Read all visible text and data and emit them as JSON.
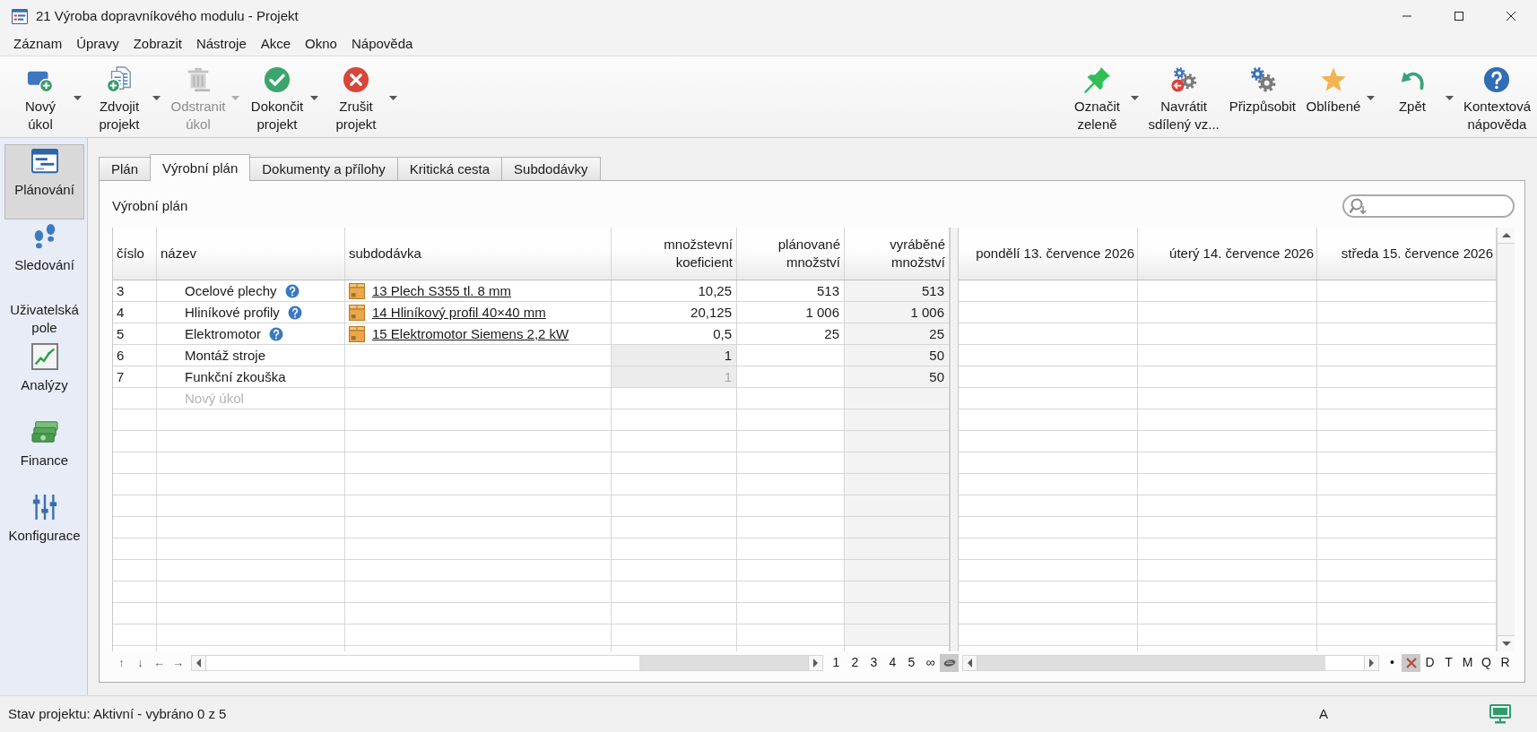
{
  "window": {
    "title": "21 Výroba dopravníkového modulu - Projekt"
  },
  "menu": [
    "Záznam",
    "Úpravy",
    "Zobrazit",
    "Nástroje",
    "Akce",
    "Okno",
    "Nápověda"
  ],
  "toolbar": {
    "left": [
      {
        "lines": [
          "Nový",
          "úkol"
        ],
        "dropdown": true,
        "disabled": false
      },
      {
        "lines": [
          "Zdvojit",
          "projekt"
        ],
        "dropdown": true,
        "disabled": false
      },
      {
        "lines": [
          "Odstranit",
          "úkol"
        ],
        "dropdown": true,
        "disabled": true
      },
      {
        "lines": [
          "Dokončit",
          "projekt"
        ],
        "dropdown": true,
        "disabled": false
      },
      {
        "lines": [
          "Zrušit",
          "projekt"
        ],
        "dropdown": true,
        "disabled": false
      }
    ],
    "right": [
      {
        "lines": [
          "Označit",
          "zeleně"
        ],
        "dropdown": true,
        "disabled": false
      },
      {
        "lines": [
          "Navrátit",
          "sdílený vz..."
        ],
        "dropdown": false,
        "disabled": false
      },
      {
        "lines": [
          "Přizpůsobit"
        ],
        "dropdown": false,
        "disabled": false
      },
      {
        "lines": [
          "Oblíbené"
        ],
        "dropdown": true,
        "disabled": false
      },
      {
        "lines": [
          "Zpět"
        ],
        "dropdown": true,
        "disabled": false
      },
      {
        "lines": [
          "Kontextová",
          "nápověda"
        ],
        "dropdown": false,
        "disabled": false
      }
    ]
  },
  "sidebar": {
    "items": [
      {
        "label": "Plánování",
        "selected": true
      },
      {
        "label": "Sledování",
        "selected": false
      },
      {
        "label": "Uživatelská pole",
        "selected": false
      },
      {
        "label": "Analýzy",
        "selected": false
      },
      {
        "label": "Finance",
        "selected": false
      },
      {
        "label": "Konfigurace",
        "selected": false
      }
    ]
  },
  "tabs": [
    {
      "label": "Plán",
      "selected": false
    },
    {
      "label": "Výrobní plán",
      "selected": true
    },
    {
      "label": "Dokumenty a přílohy",
      "selected": false
    },
    {
      "label": "Kritická cesta",
      "selected": false
    },
    {
      "label": "Subdodávky",
      "selected": false
    }
  ],
  "panel": {
    "title": "Výrobní plán"
  },
  "grid": {
    "columns": [
      {
        "label": "číslo",
        "kind": "text",
        "readonly": false
      },
      {
        "label": "název",
        "kind": "text",
        "readonly": false
      },
      {
        "label": "subdodávka",
        "kind": "text",
        "readonly": false
      },
      {
        "label": "množstevní koeficient",
        "kind": "number",
        "readonly": false
      },
      {
        "label": "plánované množství",
        "kind": "number",
        "readonly": false
      },
      {
        "label": "vyráběné množství",
        "kind": "number",
        "readonly": true
      }
    ],
    "rows": [
      {
        "number": "3",
        "name": "Ocelové plechy",
        "help": true,
        "subdelivery": "13 Plech S355 tl. 8 mm",
        "coefficient": "10,25",
        "coefficient_locked": false,
        "coefficient_dimmed": false,
        "planned": "513",
        "produced": "513"
      },
      {
        "number": "4",
        "name": "Hliníkové profily",
        "help": true,
        "subdelivery": "14 Hliníkový profil 40×40 mm",
        "coefficient": "20,125",
        "coefficient_locked": false,
        "coefficient_dimmed": false,
        "planned": "1 006",
        "produced": "1 006"
      },
      {
        "number": "5",
        "name": "Elektromotor",
        "help": true,
        "subdelivery": "15 Elektromotor Siemens 2,2 kW",
        "coefficient": "0,5",
        "coefficient_locked": false,
        "coefficient_dimmed": false,
        "planned": "25",
        "produced": "25"
      },
      {
        "number": "6",
        "name": "Montáž stroje",
        "help": false,
        "coefficient": "1",
        "coefficient_locked": true,
        "coefficient_dimmed": false,
        "produced": "50"
      },
      {
        "number": "7",
        "name": "Funkční zkouška",
        "help": false,
        "coefficient": "1",
        "coefficient_locked": true,
        "coefficient_dimmed": true,
        "produced": "50"
      }
    ],
    "new_row": {
      "placeholder": "Nový úkol"
    },
    "navigation": [
      "↑",
      "↓",
      "←",
      "→"
    ],
    "zoom_levels": [
      {
        "kind": "text",
        "label": "1",
        "selected": false
      },
      {
        "kind": "text",
        "label": "2",
        "selected": false
      },
      {
        "kind": "text",
        "label": "3",
        "selected": false
      },
      {
        "kind": "text",
        "label": "4",
        "selected": false
      },
      {
        "kind": "text",
        "label": "5",
        "selected": false
      },
      {
        "kind": "text",
        "label": "∞",
        "selected": false
      },
      {
        "kind": "icon",
        "selected": true
      }
    ]
  },
  "calendar": {
    "columns": [
      "pondělí 13. července 2026",
      "úterý 14. července 2026",
      "středa 15. července 2026"
    ],
    "time_scale": [
      {
        "kind": "text",
        "label": "•",
        "selected": false
      },
      {
        "kind": "icon",
        "selected": true
      },
      {
        "kind": "text",
        "label": "D",
        "selected": false
      },
      {
        "kind": "text",
        "label": "T",
        "selected": false
      },
      {
        "kind": "text",
        "label": "M",
        "selected": false
      },
      {
        "kind": "text",
        "label": "Q",
        "selected": false
      },
      {
        "kind": "text",
        "label": "R",
        "selected": false
      }
    ]
  },
  "status_bar": {
    "text": "Stav projektu: Aktivní - vybráno 0 z 5",
    "mode": "A"
  }
}
